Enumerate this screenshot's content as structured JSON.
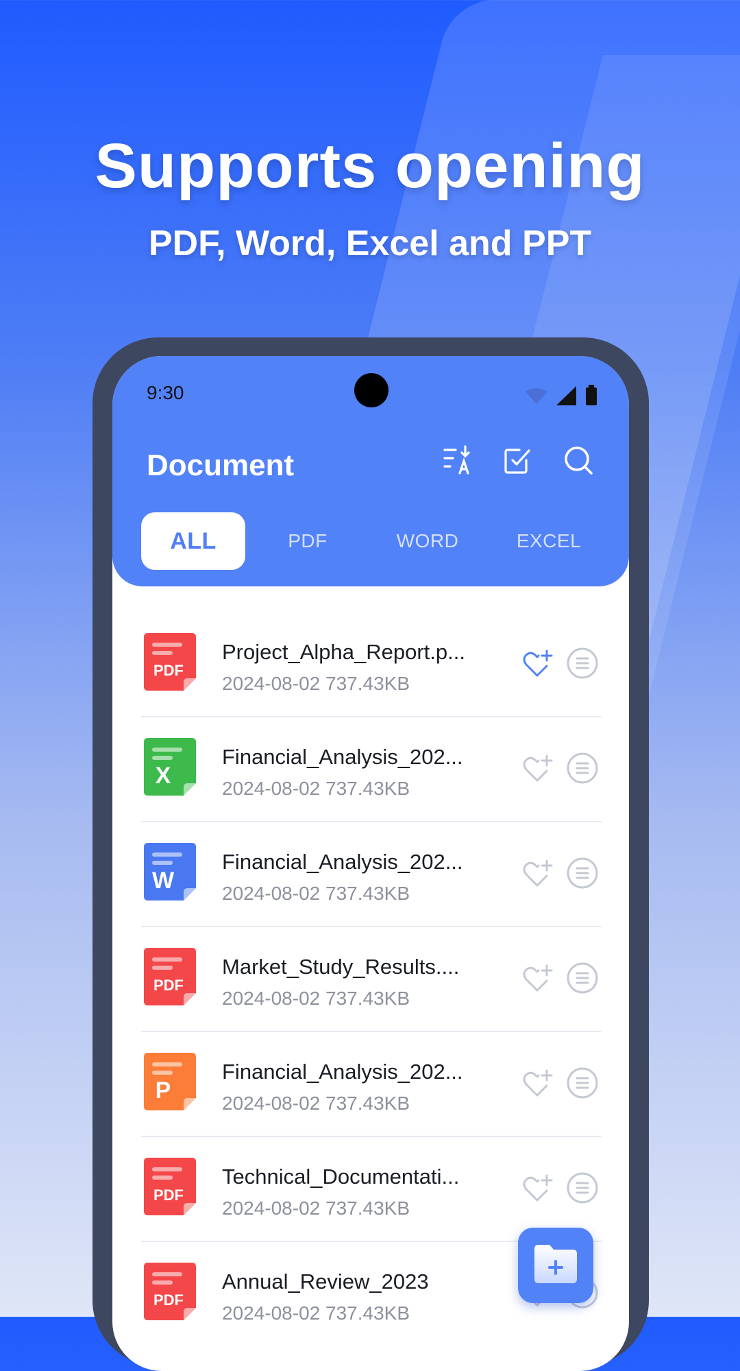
{
  "promo": {
    "headline": "Supports opening",
    "subline": "PDF, Word, Excel and PPT"
  },
  "status_bar": {
    "time": "9:30"
  },
  "app_bar": {
    "title": "Document",
    "icons": [
      "sort-az-icon",
      "select-check-icon",
      "search-icon"
    ]
  },
  "tabs": [
    {
      "label": "ALL",
      "active": true
    },
    {
      "label": "PDF",
      "active": false
    },
    {
      "label": "WORD",
      "active": false
    },
    {
      "label": "EXCEL",
      "active": false
    }
  ],
  "files": [
    {
      "type": "pdf",
      "name": "Project_Alpha_Report.p...",
      "meta": "2024-08-02 737.43KB",
      "favorite": true
    },
    {
      "type": "excel",
      "name": "Financial_Analysis_202...",
      "meta": "2024-08-02 737.43KB",
      "favorite": false
    },
    {
      "type": "word",
      "name": "Financial_Analysis_202...",
      "meta": "2024-08-02 737.43KB",
      "favorite": false
    },
    {
      "type": "pdf",
      "name": "Market_Study_Results....",
      "meta": "2024-08-02 737.43KB",
      "favorite": false
    },
    {
      "type": "ppt",
      "name": "Financial_Analysis_202...",
      "meta": "2024-08-02 737.43KB",
      "favorite": false
    },
    {
      "type": "pdf",
      "name": "Technical_Documentati...",
      "meta": "2024-08-02 737.43KB",
      "favorite": false
    },
    {
      "type": "pdf",
      "name": "Annual_Review_2023",
      "meta": "2024-08-02 737.43KB",
      "favorite": false
    }
  ],
  "file_icon_labels": {
    "pdf": "PDF",
    "excel": "X",
    "word": "W",
    "ppt": "P"
  },
  "colors": {
    "accent": "#5282f8",
    "pdf": "#f4474a",
    "excel": "#3dba4b",
    "word": "#4a78f0",
    "ppt": "#fb7d37"
  },
  "fab": {
    "icon": "add-folder-icon"
  }
}
